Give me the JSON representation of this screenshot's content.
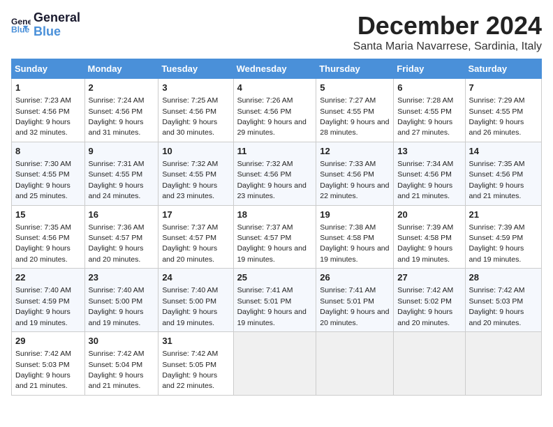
{
  "header": {
    "logo_line1": "General",
    "logo_line2": "Blue",
    "month": "December 2024",
    "location": "Santa Maria Navarrese, Sardinia, Italy"
  },
  "weekdays": [
    "Sunday",
    "Monday",
    "Tuesday",
    "Wednesday",
    "Thursday",
    "Friday",
    "Saturday"
  ],
  "weeks": [
    [
      {
        "day": "1",
        "sunrise": "7:23 AM",
        "sunset": "4:56 PM",
        "daylight": "9 hours and 32 minutes."
      },
      {
        "day": "2",
        "sunrise": "7:24 AM",
        "sunset": "4:56 PM",
        "daylight": "9 hours and 31 minutes."
      },
      {
        "day": "3",
        "sunrise": "7:25 AM",
        "sunset": "4:56 PM",
        "daylight": "9 hours and 30 minutes."
      },
      {
        "day": "4",
        "sunrise": "7:26 AM",
        "sunset": "4:56 PM",
        "daylight": "9 hours and 29 minutes."
      },
      {
        "day": "5",
        "sunrise": "7:27 AM",
        "sunset": "4:55 PM",
        "daylight": "9 hours and 28 minutes."
      },
      {
        "day": "6",
        "sunrise": "7:28 AM",
        "sunset": "4:55 PM",
        "daylight": "9 hours and 27 minutes."
      },
      {
        "day": "7",
        "sunrise": "7:29 AM",
        "sunset": "4:55 PM",
        "daylight": "9 hours and 26 minutes."
      }
    ],
    [
      {
        "day": "8",
        "sunrise": "7:30 AM",
        "sunset": "4:55 PM",
        "daylight": "9 hours and 25 minutes."
      },
      {
        "day": "9",
        "sunrise": "7:31 AM",
        "sunset": "4:55 PM",
        "daylight": "9 hours and 24 minutes."
      },
      {
        "day": "10",
        "sunrise": "7:32 AM",
        "sunset": "4:55 PM",
        "daylight": "9 hours and 23 minutes."
      },
      {
        "day": "11",
        "sunrise": "7:32 AM",
        "sunset": "4:56 PM",
        "daylight": "9 hours and 23 minutes."
      },
      {
        "day": "12",
        "sunrise": "7:33 AM",
        "sunset": "4:56 PM",
        "daylight": "9 hours and 22 minutes."
      },
      {
        "day": "13",
        "sunrise": "7:34 AM",
        "sunset": "4:56 PM",
        "daylight": "9 hours and 21 minutes."
      },
      {
        "day": "14",
        "sunrise": "7:35 AM",
        "sunset": "4:56 PM",
        "daylight": "9 hours and 21 minutes."
      }
    ],
    [
      {
        "day": "15",
        "sunrise": "7:35 AM",
        "sunset": "4:56 PM",
        "daylight": "9 hours and 20 minutes."
      },
      {
        "day": "16",
        "sunrise": "7:36 AM",
        "sunset": "4:57 PM",
        "daylight": "9 hours and 20 minutes."
      },
      {
        "day": "17",
        "sunrise": "7:37 AM",
        "sunset": "4:57 PM",
        "daylight": "9 hours and 20 minutes."
      },
      {
        "day": "18",
        "sunrise": "7:37 AM",
        "sunset": "4:57 PM",
        "daylight": "9 hours and 19 minutes."
      },
      {
        "day": "19",
        "sunrise": "7:38 AM",
        "sunset": "4:58 PM",
        "daylight": "9 hours and 19 minutes."
      },
      {
        "day": "20",
        "sunrise": "7:39 AM",
        "sunset": "4:58 PM",
        "daylight": "9 hours and 19 minutes."
      },
      {
        "day": "21",
        "sunrise": "7:39 AM",
        "sunset": "4:59 PM",
        "daylight": "9 hours and 19 minutes."
      }
    ],
    [
      {
        "day": "22",
        "sunrise": "7:40 AM",
        "sunset": "4:59 PM",
        "daylight": "9 hours and 19 minutes."
      },
      {
        "day": "23",
        "sunrise": "7:40 AM",
        "sunset": "5:00 PM",
        "daylight": "9 hours and 19 minutes."
      },
      {
        "day": "24",
        "sunrise": "7:40 AM",
        "sunset": "5:00 PM",
        "daylight": "9 hours and 19 minutes."
      },
      {
        "day": "25",
        "sunrise": "7:41 AM",
        "sunset": "5:01 PM",
        "daylight": "9 hours and 19 minutes."
      },
      {
        "day": "26",
        "sunrise": "7:41 AM",
        "sunset": "5:01 PM",
        "daylight": "9 hours and 20 minutes."
      },
      {
        "day": "27",
        "sunrise": "7:42 AM",
        "sunset": "5:02 PM",
        "daylight": "9 hours and 20 minutes."
      },
      {
        "day": "28",
        "sunrise": "7:42 AM",
        "sunset": "5:03 PM",
        "daylight": "9 hours and 20 minutes."
      }
    ],
    [
      {
        "day": "29",
        "sunrise": "7:42 AM",
        "sunset": "5:03 PM",
        "daylight": "9 hours and 21 minutes."
      },
      {
        "day": "30",
        "sunrise": "7:42 AM",
        "sunset": "5:04 PM",
        "daylight": "9 hours and 21 minutes."
      },
      {
        "day": "31",
        "sunrise": "7:42 AM",
        "sunset": "5:05 PM",
        "daylight": "9 hours and 22 minutes."
      },
      null,
      null,
      null,
      null
    ]
  ],
  "labels": {
    "sunrise": "Sunrise:",
    "sunset": "Sunset:",
    "daylight": "Daylight:"
  }
}
